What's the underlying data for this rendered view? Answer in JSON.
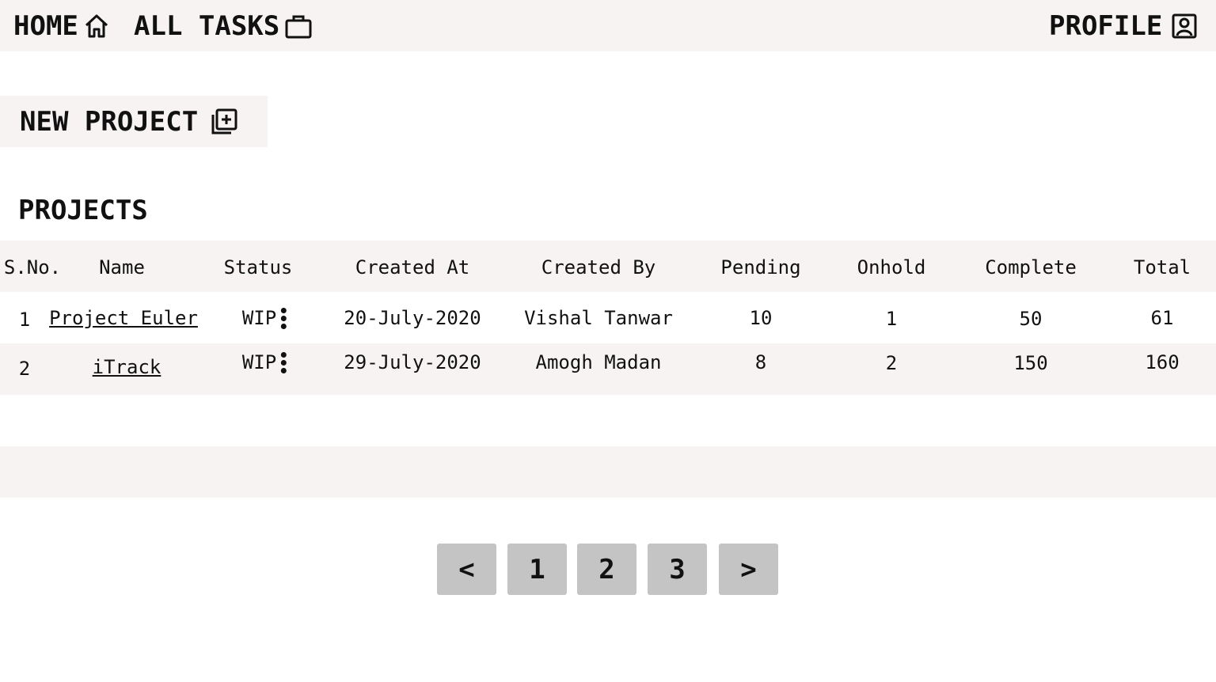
{
  "nav": {
    "home_label": "HOME",
    "home_icon": "home-icon",
    "tasks_label": "ALL TASKS",
    "tasks_icon": "briefcase-icon",
    "profile_label": "PROFILE",
    "profile_icon": "profile-icon"
  },
  "new_project": {
    "label": "NEW PROJECT",
    "icon": "add-stack-icon"
  },
  "section_title": "PROJECTS",
  "table": {
    "headers": [
      "S.No.",
      "Name",
      "Status",
      "Created At",
      "Created By",
      "Pending",
      "Onhold",
      "Complete",
      "Total"
    ],
    "rows": [
      {
        "sno": "1",
        "name": "Project Euler",
        "status": "WIP",
        "created_at": "20-July-2020",
        "created_by": "Vishal Tanwar",
        "pending": "10",
        "onhold": "1",
        "complete": "50",
        "total": "61"
      },
      {
        "sno": "2",
        "name": "iTrack",
        "status": "WIP",
        "created_at": "29-July-2020",
        "created_by": "Amogh Madan",
        "pending": "8",
        "onhold": "2",
        "complete": "150",
        "total": "160"
      }
    ]
  },
  "pagination": {
    "prev": "<",
    "pages": [
      "1",
      "2",
      "3"
    ],
    "next": ">"
  },
  "colors": {
    "panel_bg": "#f6f3f2",
    "pager_bg": "#c4c4c4",
    "text": "#111111"
  }
}
